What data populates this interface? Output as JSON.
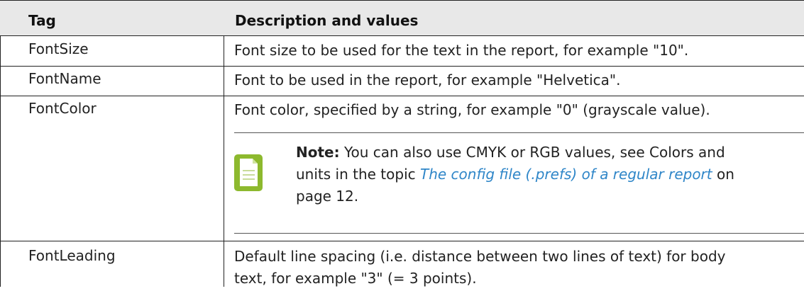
{
  "table": {
    "headers": {
      "tag": "Tag",
      "description": "Description and values"
    },
    "rows": [
      {
        "tag": "FontSize",
        "description": "Font size to be used for the text in the report, for example \"10\"."
      },
      {
        "tag": "FontName",
        "description": "Font to be used in the report, for example \"Helvetica\"."
      },
      {
        "tag": "FontColor",
        "description": "Font color, specified by a string, for example \"0\" (grayscale value).",
        "note": {
          "icon": "note-document-icon",
          "label": "Note:",
          "line1_text": "You can also use CMYK or RGB values, see Colors and",
          "line2_prefix": "units in the topic",
          "link_text": "The config file (.prefs) of a regular report",
          "line2_suffix": "on",
          "line3_text": "page 12."
        }
      },
      {
        "tag": "FontLeading",
        "description_line1": "Default line spacing (i.e. distance between two lines of text) for body",
        "description_line2": "text, for example \"3\" (= 3 points)."
      }
    ]
  },
  "colors": {
    "header_bg": "#e8e8e8",
    "link": "#2f86c8",
    "note_icon": "#8db92e"
  }
}
